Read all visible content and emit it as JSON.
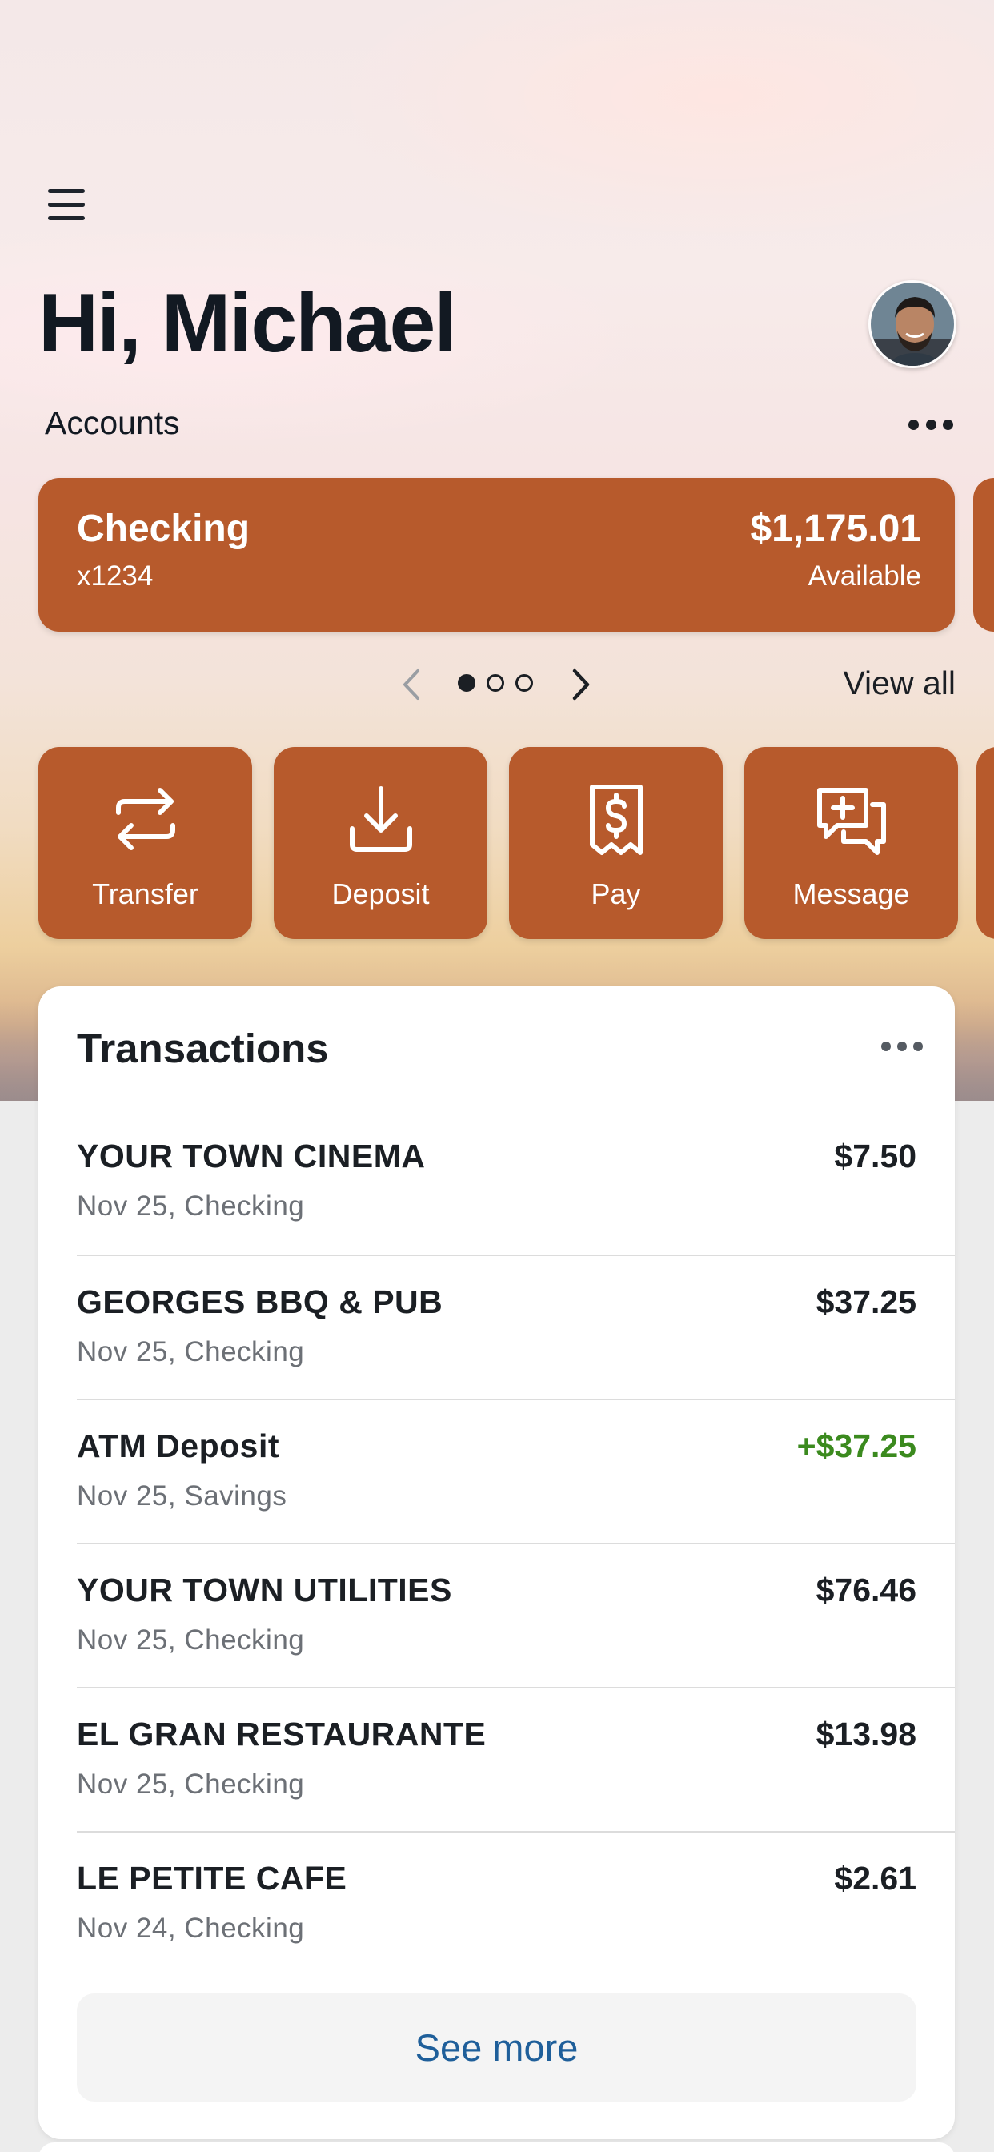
{
  "header": {
    "greeting": "Hi, Michael"
  },
  "accounts": {
    "label": "Accounts",
    "card": {
      "name": "Checking",
      "number": "x1234",
      "balance": "$1,175.01",
      "balance_label": "Available"
    },
    "pager": {
      "current": 1,
      "total": 3
    },
    "view_all": "View all"
  },
  "actions": [
    {
      "label": "Transfer",
      "icon": "transfer-arrows-icon"
    },
    {
      "label": "Deposit",
      "icon": "download-tray-icon"
    },
    {
      "label": "Pay",
      "icon": "dollar-receipt-icon"
    },
    {
      "label": "Message",
      "icon": "chat-plus-icon"
    }
  ],
  "transactions": {
    "title": "Transactions",
    "items": [
      {
        "name": "YOUR TOWN CINEMA",
        "sub": "Nov 25, Checking",
        "amount": "$7.50",
        "credit": false
      },
      {
        "name": "GEORGES BBQ & PUB",
        "sub": "Nov 25, Checking",
        "amount": "$37.25",
        "credit": false
      },
      {
        "name": "ATM Deposit",
        "sub": "Nov 25, Savings",
        "amount": "+$37.25",
        "credit": true
      },
      {
        "name": "YOUR TOWN UTILITIES",
        "sub": "Nov 25, Checking",
        "amount": "$76.46",
        "credit": false
      },
      {
        "name": "EL GRAN RESTAURANTE",
        "sub": "Nov 25, Checking",
        "amount": "$13.98",
        "credit": false
      },
      {
        "name": "LE PETITE CAFE",
        "sub": "Nov 24, Checking",
        "amount": "$2.61",
        "credit": false
      }
    ],
    "see_more": "See more"
  },
  "colors": {
    "brand": "#b75a2c",
    "credit": "#3b8a1e",
    "link": "#1f5f9a"
  }
}
